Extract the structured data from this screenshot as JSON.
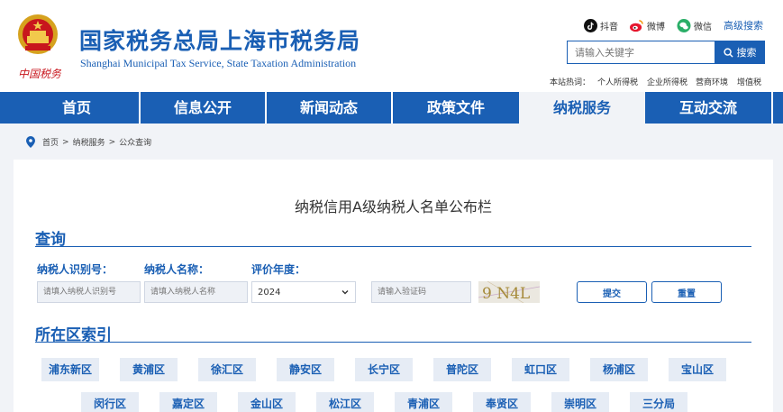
{
  "header": {
    "title_cn": "国家税务总局上海市税务局",
    "title_en": "Shanghai Municipal Tax Service, State Taxation Administration",
    "logo_text": "中国税务",
    "social": {
      "douyin": "抖音",
      "weibo": "微博",
      "wechat": "微信"
    },
    "advanced_search": "高级搜索",
    "search": {
      "placeholder": "请输入关键字",
      "button": "搜索"
    },
    "hot_label": "本站热词：",
    "hot_terms": [
      "个人所得税",
      "企业所得税",
      "营商环境",
      "增值税"
    ]
  },
  "nav": {
    "items": [
      "首页",
      "信息公开",
      "新闻动态",
      "政策文件",
      "纳税服务",
      "互动交流"
    ],
    "active_index": 4
  },
  "breadcrumb": [
    "首页",
    "纳税服务",
    "公众查询"
  ],
  "breadcrumb_sep": ">",
  "panel": {
    "title": "纳税信用A级纳税人名单公布栏",
    "query": {
      "heading": "查询",
      "taxpayer_id_label": "纳税人识别号：",
      "taxpayer_name_label": "纳税人名称：",
      "year_label": "评价年度：",
      "taxpayer_id_placeholder": "请填入纳税人识别号",
      "taxpayer_name_placeholder": "请填入纳税人名称",
      "year_value": "2024",
      "captcha_placeholder": "请输入验证码",
      "captcha_text": "9 N4L",
      "submit": "提交",
      "reset": "重置"
    },
    "district_index": {
      "heading": "所在区索引",
      "row1": [
        "浦东新区",
        "黄浦区",
        "徐汇区",
        "静安区",
        "长宁区",
        "普陀区",
        "虹口区",
        "杨浦区",
        "宝山区"
      ],
      "row2": [
        "闵行区",
        "嘉定区",
        "金山区",
        "松江区",
        "青浦区",
        "奉贤区",
        "崇明区",
        "三分局"
      ]
    }
  },
  "colors": {
    "brand": "#1a5fb4",
    "nav_active_bg": "#f1f3f7",
    "district_bg": "#e6ecf5"
  },
  "icons": [
    "national-emblem-icon",
    "douyin-icon",
    "weibo-icon",
    "wechat-icon",
    "search-icon",
    "location-pin-icon",
    "chevron-down-icon"
  ]
}
